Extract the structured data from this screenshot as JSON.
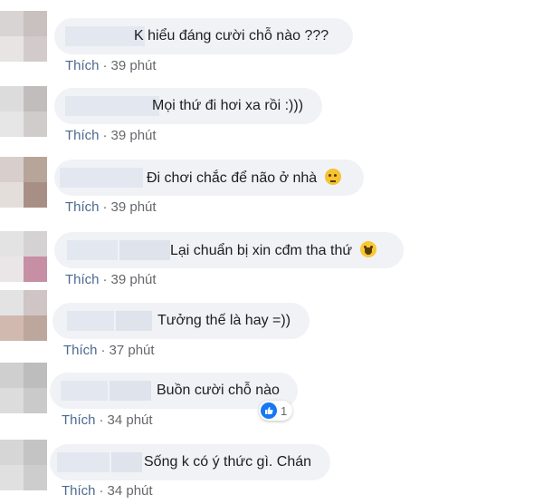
{
  "comments": [
    {
      "text": "K hiểu đáng cười chỗ nào ???",
      "like": "Thích",
      "time": "39 phút"
    },
    {
      "text": "Mọi thứ đi hơi xa rồi :)))",
      "like": "Thích",
      "time": "39 phút"
    },
    {
      "text": "Đi chơi chắc để não ở nhà",
      "emoji": "thinking-face-emoji",
      "like": "Thích",
      "time": "39 phút"
    },
    {
      "text": "Lại chuẩn bị xin cđm tha thứ",
      "emoji": "laughing-face-emoji",
      "like": "Thích",
      "time": "39 phút"
    },
    {
      "text": "Tưởng thế là hay =))",
      "like": "Thích",
      "time": "37 phút"
    },
    {
      "text": "Buồn cười chỗ nào",
      "like": "Thích",
      "time": "34 phút",
      "reactions": {
        "icon": "like-reaction-icon",
        "count": "1"
      }
    },
    {
      "text": "Sống k có ý thức gì. Chán",
      "like": "Thích",
      "time": "34 phút"
    }
  ],
  "separator": "·",
  "colors": {
    "bubble": "#f0f2f5",
    "meta": "#65676b",
    "link": "#4b6a8f",
    "like_blue": "#1877f2"
  }
}
